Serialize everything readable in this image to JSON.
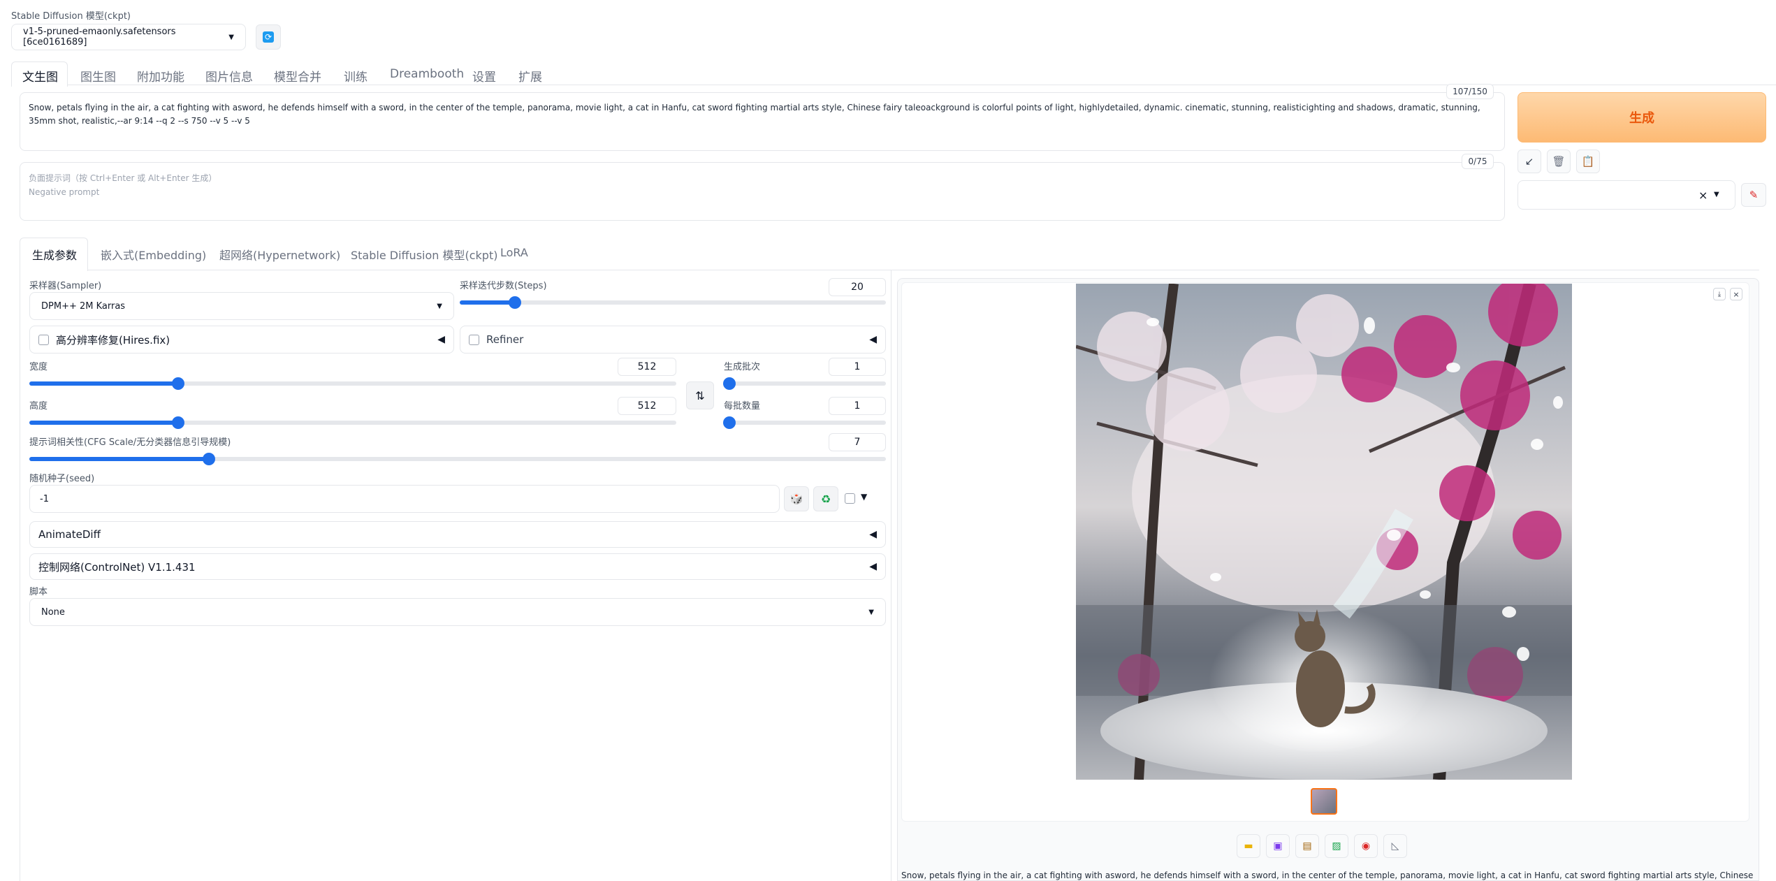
{
  "header": {
    "model_label": "Stable Diffusion 模型(ckpt)",
    "model_value": "v1-5-pruned-emaonly.safetensors [6ce0161689]"
  },
  "main_tabs": [
    "文生图",
    "图生图",
    "附加功能",
    "图片信息",
    "模型合并",
    "训练",
    "Dreambooth",
    "设置",
    "扩展"
  ],
  "prompt": {
    "text": "Snow, petals flying in the air, a cat fighting with asword, he defends himself with a sword, in the center of the temple, panorama, movie light, a cat in Hanfu, cat sword fighting martial arts style, Chinese fairy taleoackground is colorful points of light, highlydetailed, dynamic. cinematic, stunning, realisticighting and shadows, dramatic, stunning, 35mm shot, realistic,--ar 9:14 --q 2 --s 750 --v 5 --v 5",
    "token_count": "107/150"
  },
  "negative_prompt": {
    "placeholder_line1": "负面提示词（按 Ctrl+Enter 或 Alt+Enter 生成）",
    "placeholder_line2": "Negative prompt",
    "token_count": "0/75"
  },
  "generate_button": "生成",
  "style_select": {
    "clear_glyph": "×"
  },
  "sub_tabs": [
    "生成参数",
    "嵌入式(Embedding)",
    "超网络(Hypernetwork)",
    "Stable Diffusion 模型(ckpt)",
    "LoRA"
  ],
  "params": {
    "sampler_label": "采样器(Sampler)",
    "sampler_value": "DPM++ 2M Karras",
    "steps_label": "采样迭代步数(Steps)",
    "steps_value": "20",
    "steps_fraction": 0.13,
    "hires_label": "高分辨率修复(Hires.fix)",
    "refiner_label": "Refiner",
    "width_label": "宽度",
    "width_value": "512",
    "width_fraction": 0.23,
    "height_label": "高度",
    "height_value": "512",
    "height_fraction": 0.23,
    "batch_count_label": "生成批次",
    "batch_count_value": "1",
    "batch_count_fraction": 0.0,
    "batch_size_label": "每批数量",
    "batch_size_value": "1",
    "batch_size_fraction": 0.0,
    "cfg_label": "提示词相关性(CFG Scale/无分类器信息引导规模)",
    "cfg_value": "7",
    "cfg_fraction": 0.21,
    "seed_label": "随机种子(seed)",
    "seed_value": "-1",
    "animatediff_label": "AnimateDiff",
    "controlnet_label": "控制网络(ControlNet) V1.1.431",
    "script_label": "脚本",
    "script_value": "None"
  },
  "output": {
    "caption": "Snow, petals flying in the air, a cat fighting with asword, he defends himself with a sword, in the center of the temple, panorama, movie light, a cat in Hanfu, cat sword fighting martial arts style, Chinese fairy"
  },
  "colors": {
    "accent_blue": "#1f6feb",
    "generate_orange": "#f97316",
    "generate_bg": "#fdba74"
  }
}
